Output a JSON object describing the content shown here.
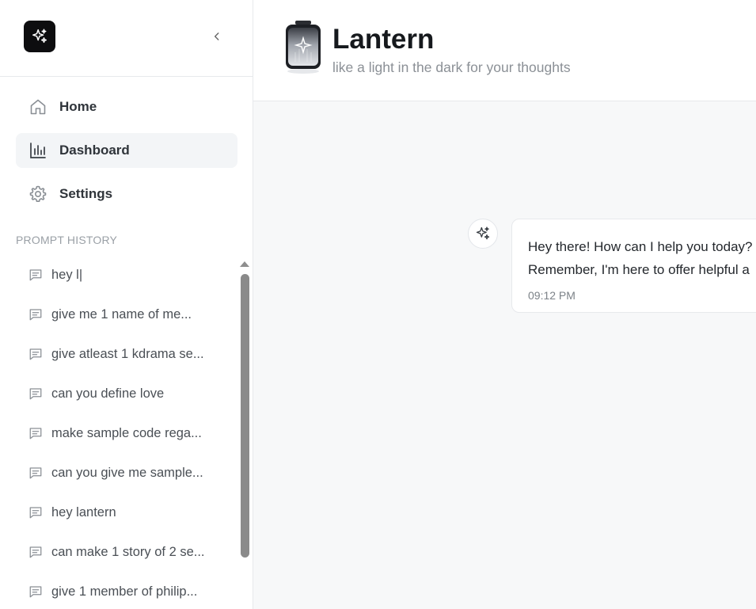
{
  "sidebar": {
    "collapse_icon": "chevron-left-icon",
    "logo_icon": "sparkle-icon",
    "nav": [
      {
        "label": "Home",
        "icon": "home-icon",
        "active": false
      },
      {
        "label": "Dashboard",
        "icon": "bar-chart-icon",
        "active": true
      },
      {
        "label": "Settings",
        "icon": "gear-icon",
        "active": false
      }
    ],
    "history_label": "PROMPT HISTORY",
    "history": [
      "hey l|",
      "give me 1 name of me...",
      "give atleast 1 kdrama se...",
      "can you define love",
      "make sample code rega...",
      "can you give me sample...",
      "hey lantern",
      "can make 1 story of 2 se...",
      "give 1 member of philip..."
    ]
  },
  "header": {
    "title": "Lantern",
    "subtitle": "like a light in the dark for your thoughts"
  },
  "chat": {
    "messages": [
      {
        "line1": "Hey there! How can I help you today?",
        "line2": "Remember, I'm here to offer helpful a",
        "time": "09:12 PM"
      }
    ]
  },
  "colors": {
    "logo_bg": "#0d0d0f",
    "active_nav_bg": "#f3f5f7",
    "main_bg": "#f7f8f9"
  }
}
